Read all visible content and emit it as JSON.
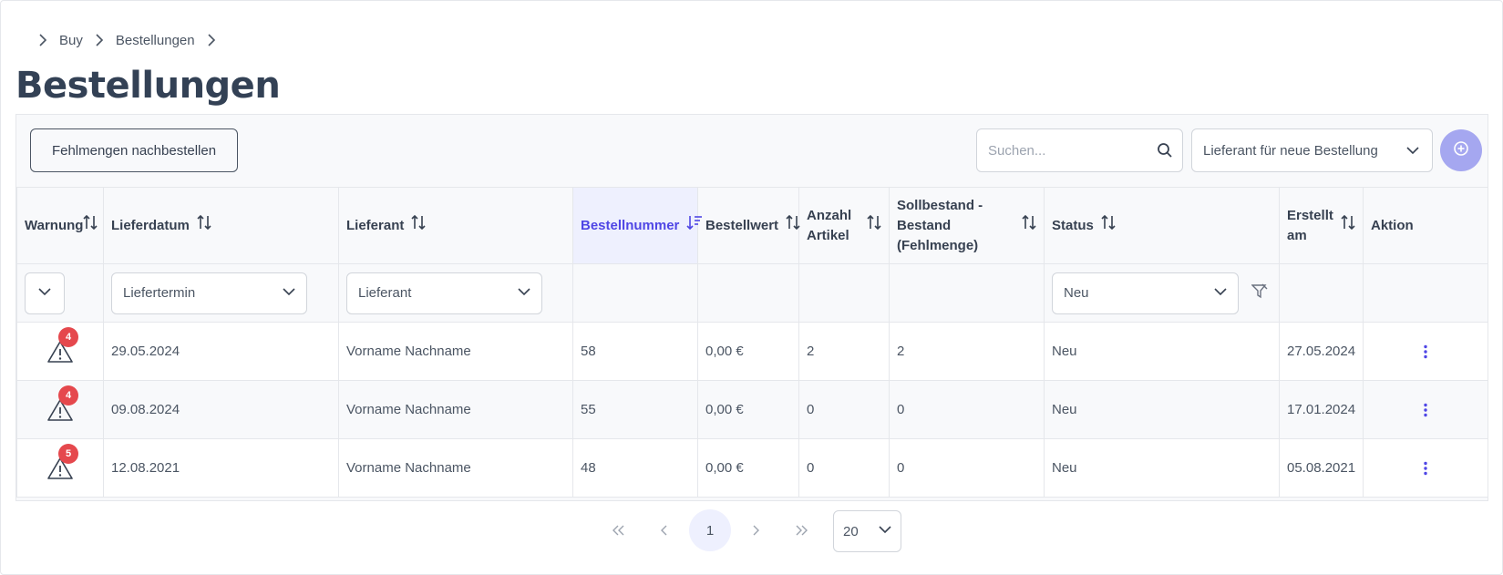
{
  "breadcrumb": {
    "items": [
      "Buy",
      "Bestellungen"
    ]
  },
  "page": {
    "title": "Bestellungen"
  },
  "toolbar": {
    "reorder_label": "Fehlmengen nachbestellen",
    "search_placeholder": "Suchen...",
    "supplier_select_placeholder": "Lieferant für neue Bestellung"
  },
  "table": {
    "headers": {
      "warning": "Warnung",
      "delivery_date": "Lieferdatum",
      "supplier": "Lieferant",
      "order_number": "Bestellnummer",
      "order_value": "Bestellwert",
      "article_count_line1": "Anzahl",
      "article_count_line2": "Artikel",
      "target_stock_line1": "Sollbestand -",
      "target_stock_line2": "Bestand",
      "target_stock_line3": "(Fehlmenge)",
      "status": "Status",
      "created_line1": "Erstellt",
      "created_line2": "am",
      "action": "Aktion"
    },
    "filters": {
      "delivery_date_placeholder": "Liefertermin",
      "supplier_placeholder": "Lieferant",
      "status_value": "Neu"
    },
    "rows": [
      {
        "warnings": "4",
        "delivery_date": "29.05.2024",
        "supplier": "Vorname Nachname",
        "order_number": "58",
        "order_value": "0,00 €",
        "article_count": "2",
        "shortfall": "2",
        "status": "Neu",
        "created": "27.05.2024"
      },
      {
        "warnings": "4",
        "delivery_date": "09.08.2024",
        "supplier": "Vorname Nachname",
        "order_number": "55",
        "order_value": "0,00 €",
        "article_count": "0",
        "shortfall": "0",
        "status": "Neu",
        "created": "17.01.2024"
      },
      {
        "warnings": "5",
        "delivery_date": "12.08.2021",
        "supplier": "Vorname Nachname",
        "order_number": "48",
        "order_value": "0,00 €",
        "article_count": "0",
        "shortfall": "0",
        "status": "Neu",
        "created": "05.08.2021"
      }
    ]
  },
  "pagination": {
    "current_page": "1",
    "rows_per_page": "20"
  },
  "colors": {
    "accent": "#4f46e5",
    "accent_light": "#a5a7f0",
    "badge": "#e5484d"
  }
}
